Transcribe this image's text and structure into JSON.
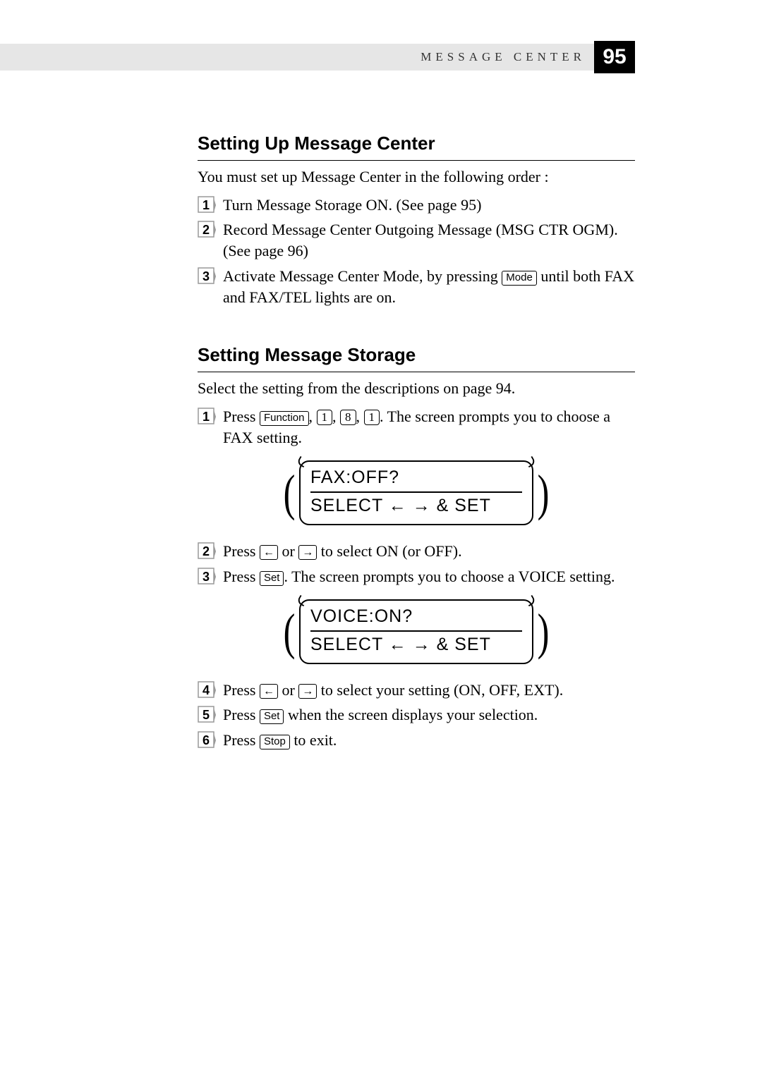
{
  "header": {
    "section_label": "MESSAGE CENTER",
    "page_number": "95"
  },
  "sections": {
    "s1": {
      "heading": "Setting Up Message Center",
      "intro": "You must set up Message Center in the following order :",
      "steps": {
        "n1": {
          "text": "Turn Message Storage ON. (See page 95)"
        },
        "n2": {
          "text": "Record Message Center Outgoing Message (MSG CTR OGM). (See page 96)"
        },
        "n3": {
          "pre": "Activate Message Center Mode, by pressing ",
          "key": "Mode",
          "post": " until both FAX and FAX/TEL lights are on."
        }
      }
    },
    "s2": {
      "heading": "Setting Message Storage",
      "intro": "Select the setting from the descriptions on page 94.",
      "steps": {
        "n1": {
          "pre": "Press ",
          "k1": "Function",
          "c1": ", ",
          "k2": "1",
          "c2": ", ",
          "k3": "8",
          "c3": ", ",
          "k4": "1",
          "post": ". The screen prompts you to choose a FAX setting."
        },
        "n2": {
          "pre": "Press ",
          "k1": "←",
          "mid": " or ",
          "k2": "→",
          "post": " to select ON (or OFF)."
        },
        "n3": {
          "pre": "Press ",
          "k1": "Set",
          "post": ". The screen prompts you to choose a VOICE setting."
        },
        "n4": {
          "pre": "Press ",
          "k1": "←",
          "mid": " or ",
          "k2": "→",
          "post": " to select your setting (ON, OFF, EXT)."
        },
        "n5": {
          "pre": "Press ",
          "k1": "Set",
          "post": " when the screen displays your selection."
        },
        "n6": {
          "pre": "Press ",
          "k1": "Stop",
          "post": " to exit."
        }
      },
      "lcd1": {
        "line1": "FAX:OFF?",
        "line2": "SELECT ←  → & SET"
      },
      "lcd2": {
        "line1": "VOICE:ON?",
        "line2": "SELECT ←  → & SET"
      }
    }
  }
}
